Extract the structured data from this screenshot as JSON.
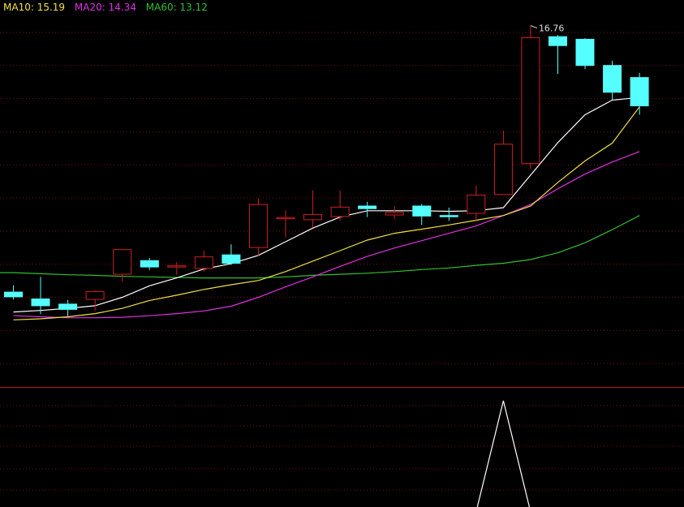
{
  "chart_data": {
    "type": "candlestick",
    "indicators": [
      {
        "name": "MA10",
        "value": "15.19",
        "color": "#f0e040"
      },
      {
        "name": "MA20",
        "value": "14.34",
        "color": "#e030e0"
      },
      {
        "name": "MA60",
        "value": "13.12",
        "color": "#30c030"
      }
    ],
    "annotation": {
      "text": "16.76",
      "index": 19
    },
    "candles": [
      {
        "o": 11.66,
        "h": 11.79,
        "l": 11.52,
        "c": 11.57
      },
      {
        "o": 11.53,
        "h": 11.95,
        "l": 11.24,
        "c": 11.4
      },
      {
        "o": 11.43,
        "h": 11.51,
        "l": 11.2,
        "c": 11.33
      },
      {
        "o": 11.52,
        "h": 11.69,
        "l": 11.3,
        "c": 11.67
      },
      {
        "o": 12.0,
        "h": 12.38,
        "l": 11.86,
        "c": 12.47
      },
      {
        "o": 12.26,
        "h": 12.31,
        "l": 12.08,
        "c": 12.14
      },
      {
        "o": 12.16,
        "h": 12.23,
        "l": 11.99,
        "c": 12.16
      },
      {
        "o": 12.11,
        "h": 12.45,
        "l": 12.05,
        "c": 12.33
      },
      {
        "o": 12.37,
        "h": 12.57,
        "l": 12.18,
        "c": 12.21
      },
      {
        "o": 12.51,
        "h": 13.45,
        "l": 12.34,
        "c": 13.33
      },
      {
        "o": 13.08,
        "h": 13.22,
        "l": 12.7,
        "c": 13.08
      },
      {
        "o": 13.04,
        "h": 13.6,
        "l": 12.89,
        "c": 13.14
      },
      {
        "o": 13.1,
        "h": 13.6,
        "l": 13.02,
        "c": 13.28
      },
      {
        "o": 13.3,
        "h": 13.38,
        "l": 13.09,
        "c": 13.25
      },
      {
        "o": 13.13,
        "h": 13.3,
        "l": 13.05,
        "c": 13.18
      },
      {
        "o": 13.3,
        "h": 13.34,
        "l": 12.94,
        "c": 13.11
      },
      {
        "o": 13.12,
        "h": 13.27,
        "l": 13.02,
        "c": 13.1
      },
      {
        "o": 13.16,
        "h": 13.69,
        "l": 13.0,
        "c": 13.51
      },
      {
        "o": 13.52,
        "h": 14.74,
        "l": 13.52,
        "c": 14.48
      },
      {
        "o": 14.11,
        "h": 16.74,
        "l": 14.01,
        "c": 16.51
      },
      {
        "o": 16.53,
        "h": 16.56,
        "l": 15.82,
        "c": 16.36
      },
      {
        "o": 16.48,
        "h": 16.5,
        "l": 15.91,
        "c": 15.98
      },
      {
        "o": 15.98,
        "h": 16.07,
        "l": 15.33,
        "c": 15.47
      },
      {
        "o": 15.75,
        "h": 15.84,
        "l": 15.04,
        "c": 15.21
      }
    ],
    "ma_lines": {
      "MA5": [
        11.28,
        11.31,
        11.35,
        11.4,
        11.56,
        11.78,
        11.93,
        12.1,
        12.2,
        12.36,
        12.62,
        12.88,
        13.09,
        13.21,
        13.21,
        13.21,
        13.2,
        13.21,
        13.27,
        13.89,
        14.51,
        15.04,
        15.32,
        15.37
      ],
      "MA10": [
        11.13,
        11.15,
        11.19,
        11.25,
        11.35,
        11.5,
        11.6,
        11.71,
        11.8,
        11.88,
        12.05,
        12.25,
        12.45,
        12.65,
        12.78,
        12.86,
        12.94,
        13.03,
        13.12,
        13.3,
        13.75,
        14.16,
        14.5,
        15.19
      ],
      "MA20": [
        11.21,
        11.19,
        11.17,
        11.17,
        11.18,
        11.21,
        11.25,
        11.3,
        11.39,
        11.56,
        11.76,
        11.95,
        12.15,
        12.34,
        12.5,
        12.64,
        12.78,
        12.92,
        13.12,
        13.33,
        13.63,
        13.91,
        14.14,
        14.34
      ],
      "MA60": [
        12.03,
        12.01,
        11.99,
        11.98,
        11.96,
        11.95,
        11.94,
        11.93,
        11.93,
        11.93,
        11.95,
        11.98,
        12.0,
        12.02,
        12.05,
        12.09,
        12.12,
        12.17,
        12.21,
        12.28,
        12.41,
        12.6,
        12.85,
        13.12
      ]
    },
    "lower_indicator": [
      0,
      0,
      0,
      0,
      0,
      0,
      0,
      0,
      0,
      0,
      0,
      0,
      0,
      0,
      0,
      0,
      0,
      0,
      1,
      0,
      0,
      0,
      0,
      0
    ],
    "colors": {
      "up": "#d02020",
      "down": "#55ffff",
      "ma5": "#ffffff",
      "lower": "#ffffff",
      "grid": "#7a1010"
    }
  }
}
